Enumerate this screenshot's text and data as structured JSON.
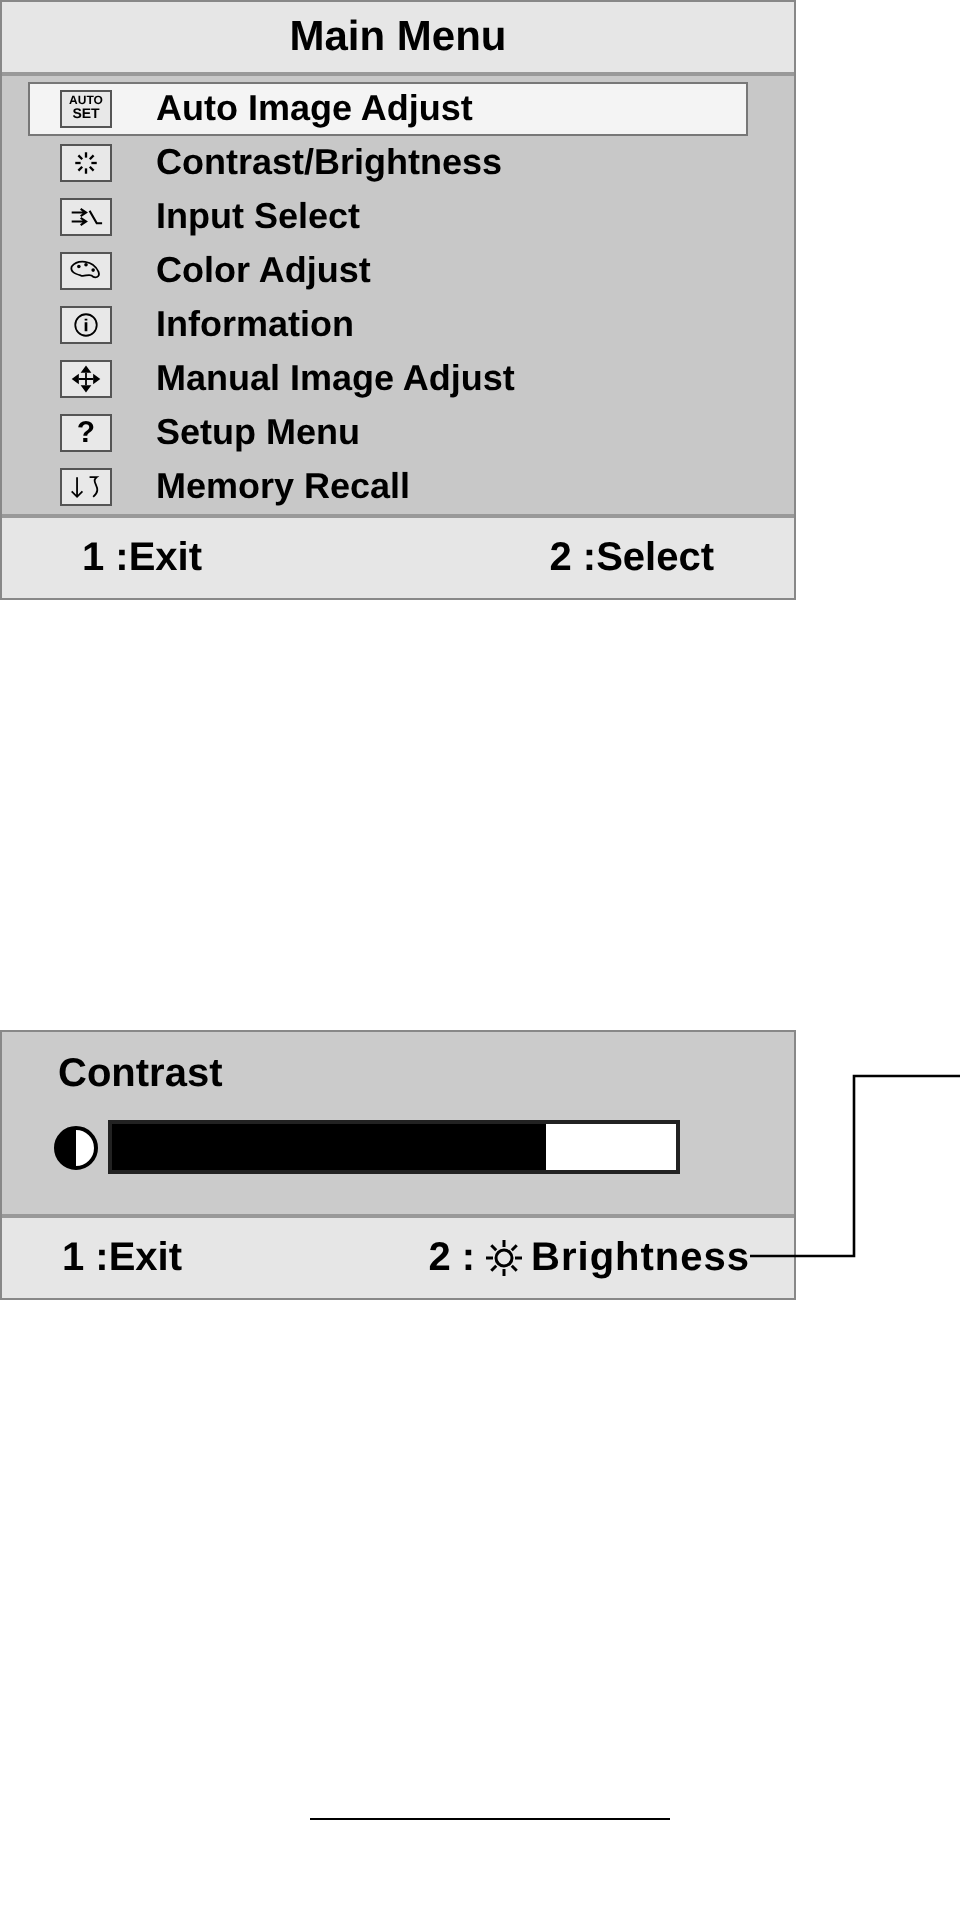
{
  "main_menu": {
    "title": "Main Menu",
    "items": [
      {
        "label": "Auto Image Adjust",
        "kind": "autoset",
        "icon_text": [
          "AUTO",
          "SET"
        ],
        "selected": true
      },
      {
        "label": "Contrast/Brightness",
        "kind": "sparkle",
        "selected": false
      },
      {
        "label": "Input Select",
        "kind": "input",
        "selected": false
      },
      {
        "label": "Color Adjust",
        "kind": "palette",
        "selected": false
      },
      {
        "label": "Information",
        "kind": "info",
        "selected": false
      },
      {
        "label": "Manual Image Adjust",
        "kind": "arrows",
        "selected": false
      },
      {
        "label": "Setup Menu",
        "kind": "question",
        "icon_text": [
          "?"
        ],
        "selected": false
      },
      {
        "label": "Memory Recall",
        "kind": "recall",
        "selected": false
      }
    ],
    "footer": [
      "1 :Exit",
      "2 :Select"
    ]
  },
  "contrast_menu": {
    "title": "Contrast",
    "level": 0.77,
    "footer_left": "1 :Exit",
    "footer_right_key": "2 :",
    "footer_right_label": "Brightness"
  }
}
